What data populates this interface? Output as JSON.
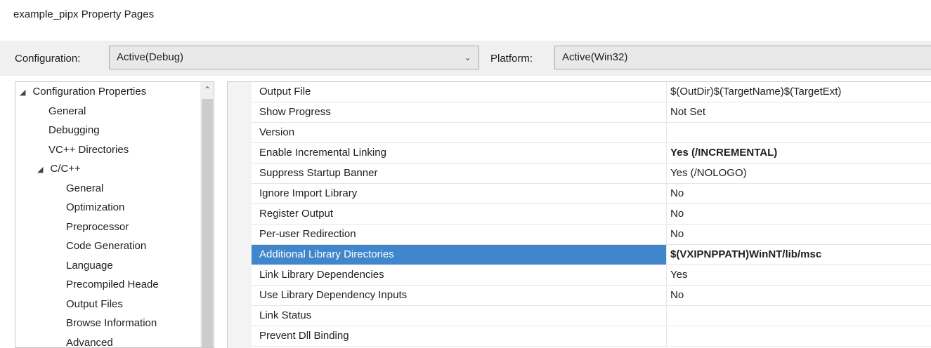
{
  "window": {
    "title": "example_pipx Property Pages"
  },
  "toolbar": {
    "configuration_label": "Configuration:",
    "configuration_value": "Active(Debug)",
    "platform_label": "Platform:",
    "platform_value": "Active(Win32)"
  },
  "tree": {
    "items": [
      {
        "label": "Configuration Properties",
        "level": 0,
        "expanded": true
      },
      {
        "label": "General",
        "level": 1
      },
      {
        "label": "Debugging",
        "level": 1
      },
      {
        "label": "VC++ Directories",
        "level": 1
      },
      {
        "label": "C/C++",
        "level": 1,
        "expanded": true
      },
      {
        "label": "General",
        "level": 2
      },
      {
        "label": "Optimization",
        "level": 2
      },
      {
        "label": "Preprocessor",
        "level": 2
      },
      {
        "label": "Code Generation",
        "level": 2
      },
      {
        "label": "Language",
        "level": 2
      },
      {
        "label": "Precompiled Heade",
        "level": 2
      },
      {
        "label": "Output Files",
        "level": 2
      },
      {
        "label": "Browse Information",
        "level": 2
      },
      {
        "label": "Advanced",
        "level": 2
      }
    ]
  },
  "properties": [
    {
      "name": "Output File",
      "value": "$(OutDir)$(TargetName)$(TargetExt)",
      "bold": false
    },
    {
      "name": "Show Progress",
      "value": "Not Set",
      "bold": false
    },
    {
      "name": "Version",
      "value": "",
      "bold": false
    },
    {
      "name": "Enable Incremental Linking",
      "value": "Yes (/INCREMENTAL)",
      "bold": true
    },
    {
      "name": "Suppress Startup Banner",
      "value": "Yes (/NOLOGO)",
      "bold": false
    },
    {
      "name": "Ignore Import Library",
      "value": "No",
      "bold": false
    },
    {
      "name": "Register Output",
      "value": "No",
      "bold": false
    },
    {
      "name": "Per-user Redirection",
      "value": "No",
      "bold": false
    },
    {
      "name": "Additional Library Directories",
      "value": "$(VXIPNPPATH)WinNT/lib/msc",
      "bold": true,
      "selected": true
    },
    {
      "name": "Link Library Dependencies",
      "value": "Yes",
      "bold": false
    },
    {
      "name": "Use Library Dependency Inputs",
      "value": "No",
      "bold": false
    },
    {
      "name": "Link Status",
      "value": "",
      "bold": false
    },
    {
      "name": "Prevent Dll Binding",
      "value": "",
      "bold": false
    }
  ],
  "colors": {
    "selection": "#3f86cc"
  }
}
